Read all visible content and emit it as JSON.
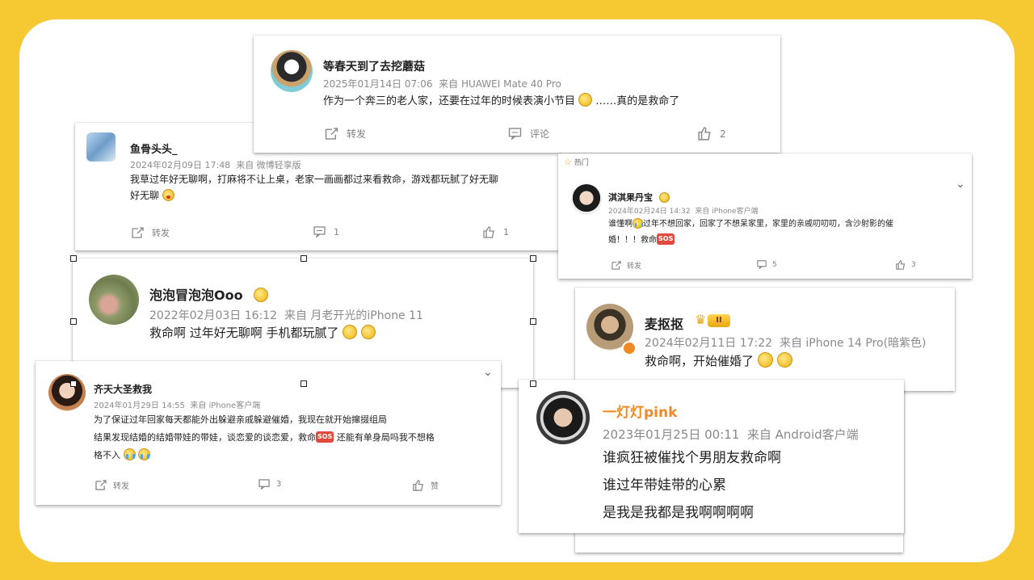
{
  "colors": {
    "background": "#f6c832",
    "board": "#ffffff",
    "accent_orange": "#f08a24"
  },
  "posts": [
    {
      "id": "post1",
      "username": "等春天到了去挖蘑菇",
      "date": "2025年01月14日 07:06",
      "source": "来自 HUAWEI Mate 40 Pro",
      "text": "作为一个奔三的老人家，还要在过年的时候表演小节目",
      "text_tail": "……真的是救命了",
      "repost": "转发",
      "comment": "评论",
      "like": "2",
      "avatar_icon": "penguin-avatar-icon"
    },
    {
      "id": "post2",
      "username": "鱼骨头头_",
      "date": "2024年02月09日 17:48",
      "source": "来自 微博轻享版",
      "text": "我草过年好无聊啊，打麻将不让上桌，老家一画画都过来看救命，游戏都玩腻了好无聊",
      "text_line2": "好无聊",
      "repost": "转发",
      "comment": "1",
      "like": "1"
    },
    {
      "id": "post3",
      "hot_label": "热门",
      "username": "淇淇果丹宝",
      "date": "2024年02月24日 14:32",
      "source": "来自 iPhone客户端",
      "text": "谁懂啊",
      "text_mid": "过年不想回家，回家了不想呆家里，家里的亲戚叨叨叨，含沙射影的催",
      "text_line2": "婚！！！救命",
      "repost": "转发",
      "comment": "5",
      "like": "3"
    },
    {
      "id": "post4",
      "username": "泡泡冒泡泡Ooo",
      "date": "2022年02月03日 16:12",
      "source": "来自 月老开光的iPhone 11",
      "text": "救命啊 过年好无聊啊 手机都玩腻了"
    },
    {
      "id": "post5",
      "username": "麦抠抠",
      "level": "II",
      "date": "2024年02月11日 17:22",
      "source": "来自 iPhone 14 Pro(暗紫色)",
      "text": "救命啊，开始催婚了"
    },
    {
      "id": "post6",
      "username": "齐天大圣救我",
      "date": "2024年01月29日 14:55",
      "source": "来自 iPhone客户端",
      "text_line1": "为了保证过年回家每天都能外出躲避亲戚躲避催婚，我现在就开始撺掇组局",
      "text_line2a": "结果发现结婚的结婚带娃的带娃，谈恋爱的谈恋爱，救命",
      "text_line2b": "还能有单身局吗我不想格",
      "text_line3": "格不入",
      "repost": "转发",
      "comment": "3",
      "like": "赞"
    },
    {
      "id": "post7",
      "username": "一灯灯pink",
      "date": "2023年01月25日 00:11",
      "source": "来自 Android客户端",
      "line1": "谁疯狂被催找个男朋友救命啊",
      "line2": "谁过年带娃带的心累",
      "line3": "是我是我都是我啊啊啊啊"
    }
  ]
}
